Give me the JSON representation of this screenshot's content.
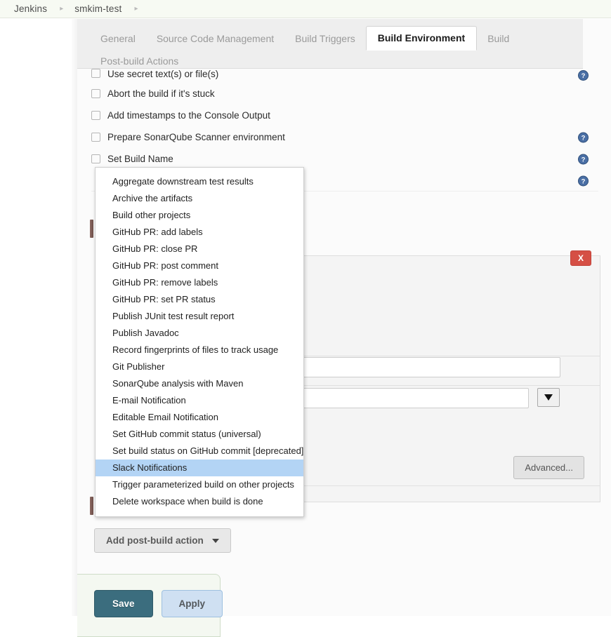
{
  "breadcrumb": {
    "items": [
      {
        "label": "Jenkins"
      },
      {
        "label": "smkim-test"
      }
    ],
    "separator": "▸"
  },
  "tabs": {
    "row1": [
      {
        "label": "General",
        "active": false
      },
      {
        "label": "Source Code Management",
        "active": false
      },
      {
        "label": "Build Triggers",
        "active": false
      },
      {
        "label": "Build Environment",
        "active": true
      },
      {
        "label": "Build",
        "active": false
      }
    ],
    "row2": [
      {
        "label": "Post-build Actions",
        "active": false
      }
    ]
  },
  "build_environment": {
    "options": [
      {
        "label": "Use secret text(s) or file(s)",
        "checked": false,
        "has_help": true
      },
      {
        "label": "Abort the build if it's stuck",
        "checked": false,
        "has_help": false
      },
      {
        "label": "Add timestamps to the Console Output",
        "checked": false,
        "has_help": false
      },
      {
        "label": "Prepare SonarQube Scanner environment",
        "checked": false,
        "has_help": true
      },
      {
        "label": "Set Build Name",
        "checked": false,
        "has_help": true
      },
      {
        "label": "",
        "checked": false,
        "has_help": true
      }
    ]
  },
  "postbuild_panel": {
    "close_label": "X",
    "advanced_label": "Advanced...",
    "fields": [
      {
        "name": "text-field-1",
        "value": "",
        "placeholder": ""
      },
      {
        "name": "combo-field-1",
        "value": "",
        "placeholder": ""
      }
    ],
    "help_icon": "help-icon",
    "caret_icon": "caret-down-icon"
  },
  "add_postbuild_button": {
    "label": "Add post-build action",
    "caret_icon": "caret-down-icon"
  },
  "postbuild_dropdown": {
    "items": [
      {
        "label": "Aggregate downstream test results",
        "selected": false
      },
      {
        "label": "Archive the artifacts",
        "selected": false
      },
      {
        "label": "Build other projects",
        "selected": false
      },
      {
        "label": "GitHub PR: add labels",
        "selected": false
      },
      {
        "label": "GitHub PR: close PR",
        "selected": false
      },
      {
        "label": "GitHub PR: post comment",
        "selected": false
      },
      {
        "label": "GitHub PR: remove labels",
        "selected": false
      },
      {
        "label": "GitHub PR: set PR status",
        "selected": false
      },
      {
        "label": "Publish JUnit test result report",
        "selected": false
      },
      {
        "label": "Publish Javadoc",
        "selected": false
      },
      {
        "label": "Record fingerprints of files to track usage",
        "selected": false
      },
      {
        "label": "Git Publisher",
        "selected": false
      },
      {
        "label": "SonarQube analysis with Maven",
        "selected": false
      },
      {
        "label": "E-mail Notification",
        "selected": false
      },
      {
        "label": "Editable Email Notification",
        "selected": false
      },
      {
        "label": "Set GitHub commit status (universal)",
        "selected": false
      },
      {
        "label": "Set build status on GitHub commit [deprecated]",
        "selected": false
      },
      {
        "label": "Slack Notifications",
        "selected": true
      },
      {
        "label": "Trigger parameterized build on other projects",
        "selected": false
      },
      {
        "label": "Delete workspace when build is done",
        "selected": false
      }
    ],
    "highlight_color": "#b3d4f5"
  },
  "footer": {
    "save_label": "Save",
    "apply_label": "Apply"
  },
  "colors": {
    "breadcrumb_bg": "#f7faf3",
    "tab_bar_bg": "#eeeeee",
    "active_tab_bg": "#ffffff",
    "save_button": "#3b6d7e",
    "apply_button": "#cfe0f2",
    "delete_button": "#d54f45",
    "help_icon": "#4a6fa5",
    "selection": "#b3d4f5"
  }
}
